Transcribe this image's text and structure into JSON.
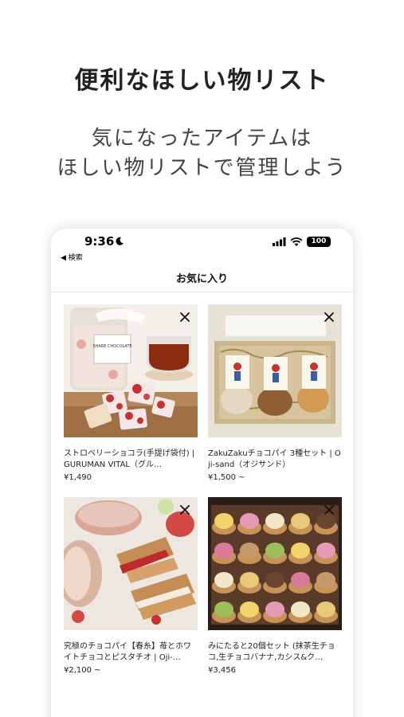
{
  "promo": {
    "headline": "便利なほしい物リスト",
    "subline1": "気になったアイテムは",
    "subline2": "ほしい物リストで管理しよう"
  },
  "status_bar": {
    "time": "9:36",
    "back_label": "◀ 検索",
    "battery": "100"
  },
  "nav": {
    "title": "お気に入り"
  },
  "items": [
    {
      "title": "ストロベリーショコラ(手提げ袋付) | GURUMAN VITAL（グル…",
      "price": "¥1,490",
      "jar_label": "SHARE CHOCOLATE"
    },
    {
      "title": "ZakuZakuチョコパイ 3種セット | Oji-sand（オジサンド）",
      "price": "¥1,500 ~"
    },
    {
      "title": "究極のチョコパイ【春糸】苺とホワイトチョコとピスタチオ | Oji-…",
      "price": "¥2,100 ~"
    },
    {
      "title": "みにたると20個セット (抹茶生チョコ,生チョコバナナ,カシス&ク…",
      "price": "¥3,456"
    }
  ],
  "icons": {
    "remove": "close-icon",
    "status": [
      "moon-icon",
      "cellular-signal-icon",
      "wifi-icon",
      "battery-icon"
    ]
  }
}
